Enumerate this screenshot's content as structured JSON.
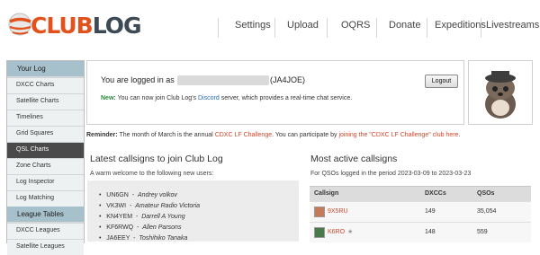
{
  "header": {
    "logo_club": "CLUB",
    "logo_log": "LOG",
    "nav": [
      "Settings",
      "Upload",
      "OQRS",
      "Donate",
      "Expeditions",
      "Livestreams"
    ]
  },
  "sidebar": {
    "sections": [
      {
        "heading": "Your Log",
        "items": [
          "DXCC Charts",
          "Satellite Charts",
          "Timelines",
          "Grid Squares",
          "QSL Charts",
          "Zone Charts",
          "Log Inspector",
          "Log Matching"
        ]
      },
      {
        "heading": "League Tables",
        "items": [
          "DXCC Leagues",
          "Satellite Leagues"
        ]
      }
    ],
    "active_item": "QSL Charts"
  },
  "login": {
    "prefix": "You are logged in as",
    "callsign": "(JA4JOE)",
    "logout_label": "Logout",
    "new_label": "New:",
    "new_text_1": "You can now join Club Log's",
    "discord": "Discord",
    "new_text_2": "server, which provides a real-time chat service."
  },
  "reminder": {
    "label": "Reminder:",
    "text_1": "The month of March is the annual",
    "challenge_link": "CDXC LF Challenge",
    "text_2": ". You can participate by",
    "join_link": "joining the \"CDXC LF Challenge\" club here",
    "text_3": "."
  },
  "latest": {
    "title": "Latest callsigns to join Club Log",
    "subtitle": "A warm welcome to the following new users:",
    "users": [
      {
        "call": "UN6GN",
        "name": "Andrey volkov"
      },
      {
        "call": "VK3WI",
        "name": "Amateur Radio Victoria"
      },
      {
        "call": "KN4YEM",
        "name": "Darrell A Young"
      },
      {
        "call": "KF6RWQ",
        "name": "Allen Parsons"
      },
      {
        "call": "JA6EEY",
        "name": "Toshihiko Tanaka"
      }
    ]
  },
  "active": {
    "title": "Most active callsigns",
    "subtitle": "For QSOs logged in the period 2023-03-09 to 2023-03-23",
    "columns": [
      "Callsign",
      "DXCCs",
      "QSOs"
    ],
    "rows": [
      {
        "call": "9X5RU",
        "dxccs": "149",
        "qsos": "35,054",
        "star": ""
      },
      {
        "call": "K6RO",
        "dxccs": "148",
        "qsos": "559",
        "star": "★"
      }
    ]
  },
  "colors": {
    "accent": "#e2521d",
    "link": "#d2462a",
    "sidebar_head": "#a6c0cc",
    "active_item": "#4a4a4a"
  }
}
